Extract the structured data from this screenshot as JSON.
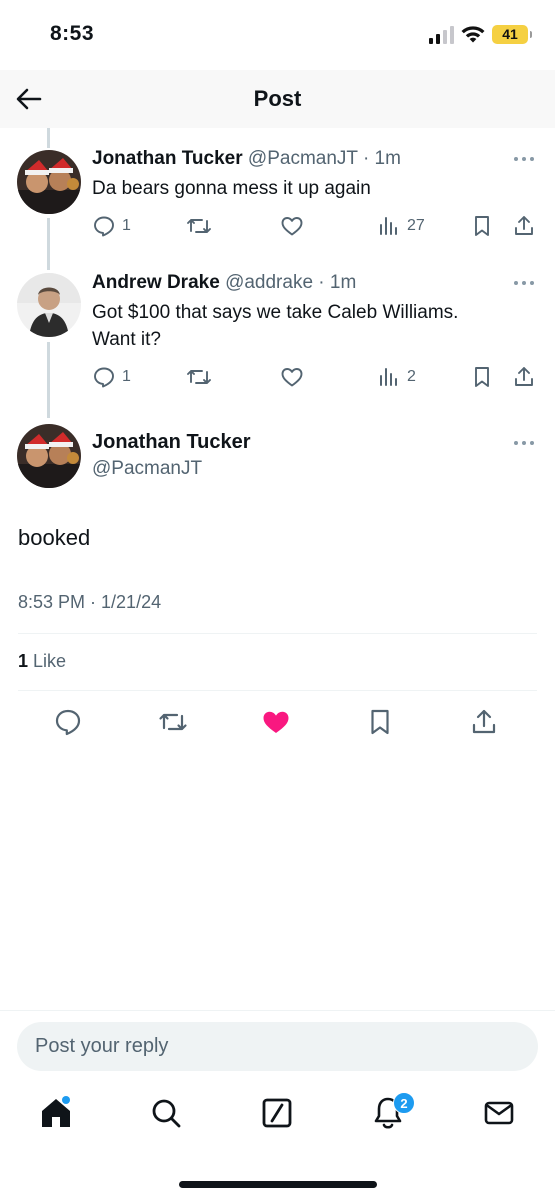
{
  "status_bar": {
    "time": "8:53",
    "battery": "41",
    "battery_color": "#f5d042"
  },
  "header": {
    "title": "Post",
    "back_icon": "arrow-left-icon"
  },
  "thread": [
    {
      "name": "Jonathan Tucker",
      "meta": "@PacmanJT · 1m",
      "text": "Da bears gonna mess it up again",
      "replies": "1",
      "views": "27"
    },
    {
      "name": "Andrew Drake",
      "meta": "@addrake · 1m",
      "text_line1": "Got $100 that says we take Caleb Williams.",
      "text_line2": "Want it?",
      "replies": "1",
      "views": "2"
    }
  ],
  "main_post": {
    "name": "Jonathan Tucker",
    "handle": "@PacmanJT",
    "text": "booked",
    "timestamp": "8:53 PM · 1/21/24",
    "like_count": "1",
    "like_label": "Like",
    "liked": true,
    "like_color": "#f91880"
  },
  "reply": {
    "placeholder": "Post your reply"
  },
  "tab_bar": {
    "items": [
      "home-icon",
      "search-icon",
      "grok-icon",
      "notifications-icon",
      "messages-icon"
    ],
    "notifications_badge": "2"
  },
  "colors": {
    "text": "#0f1419",
    "secondary": "#536471",
    "accent": "#1d9bf0",
    "like": "#f91880"
  }
}
